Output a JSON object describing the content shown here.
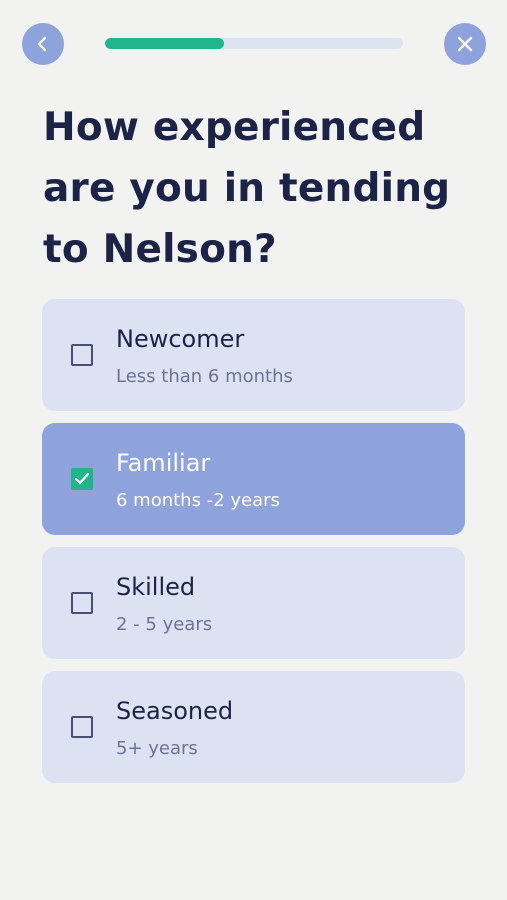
{
  "header": {
    "back_icon": "chevron-left-icon",
    "close_icon": "close-icon",
    "progress": 0.4,
    "colors": {
      "button": "#8ea3dc",
      "progress_fill": "#20b58d",
      "progress_track": "#dde3f0"
    }
  },
  "question": {
    "title": "How experienced are you in tending to Nelson?"
  },
  "options": [
    {
      "label": "Newcomer",
      "sublabel": "Less than 6 months",
      "selected": false
    },
    {
      "label": "Familiar",
      "sublabel": "6 months -2 years",
      "selected": true
    },
    {
      "label": "Skilled",
      "sublabel": "2 - 5 years",
      "selected": false
    },
    {
      "label": "Seasoned",
      "sublabel": "5+ years",
      "selected": false
    }
  ],
  "colors": {
    "background": "#f2f2f0",
    "card": "#dde2f3",
    "card_selected": "#8ea3dc",
    "check_selected": "#22b58b",
    "text_primary": "#1b2347"
  }
}
